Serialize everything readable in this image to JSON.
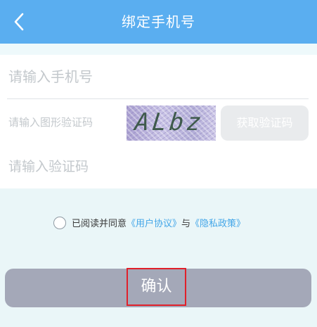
{
  "header": {
    "back_icon": "chevron-left-icon",
    "title": "绑定手机号"
  },
  "form": {
    "phone_placeholder": "请输入手机号",
    "phone_value": "",
    "captcha_placeholder": "请输入图形验证码",
    "captcha_value": "",
    "captcha_image_text": "ALbz",
    "get_code_label": "获取验证码",
    "code_placeholder": "请输入验证码",
    "code_value": ""
  },
  "agreement": {
    "checked": false,
    "prefix": "已阅读并同意",
    "user_agreement": "《用户协议》",
    "conjunction": "与",
    "privacy_policy": "《隐私政策》"
  },
  "confirm": {
    "label": "确认"
  },
  "colors": {
    "header_bg": "#5aaef0",
    "link": "#43a6e8",
    "confirm_bg": "#a4a8b8",
    "highlight_border": "#e0202a",
    "page_bg": "#eaf6f8"
  }
}
